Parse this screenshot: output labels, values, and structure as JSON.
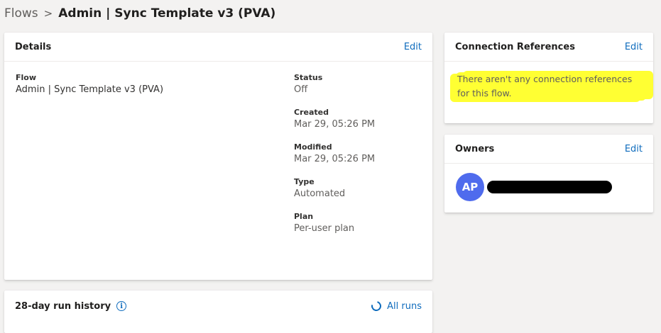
{
  "breadcrumb": {
    "root": "Flows",
    "separator": ">",
    "current": "Admin | Sync Template v3 (PVA)"
  },
  "details": {
    "title": "Details",
    "edit_label": "Edit",
    "flow_label": "Flow",
    "flow_value": "Admin | Sync Template v3 (PVA)",
    "status_label": "Status",
    "status_value": "Off",
    "created_label": "Created",
    "created_value": "Mar 29, 05:26 PM",
    "modified_label": "Modified",
    "modified_value": "Mar 29, 05:26 PM",
    "type_label": "Type",
    "type_value": "Automated",
    "plan_label": "Plan",
    "plan_value": "Per-user plan"
  },
  "connection_references": {
    "title": "Connection References",
    "edit_label": "Edit",
    "message": "There aren't any connection references for this flow."
  },
  "owners": {
    "title": "Owners",
    "edit_label": "Edit",
    "owner_initials": "AP"
  },
  "run_history": {
    "title": "28-day run history",
    "info_icon": "i",
    "all_runs_label": "All runs"
  },
  "colors": {
    "accent": "#0f6cbd",
    "avatar": "#4f6bed",
    "highlight": "#ffff33"
  }
}
